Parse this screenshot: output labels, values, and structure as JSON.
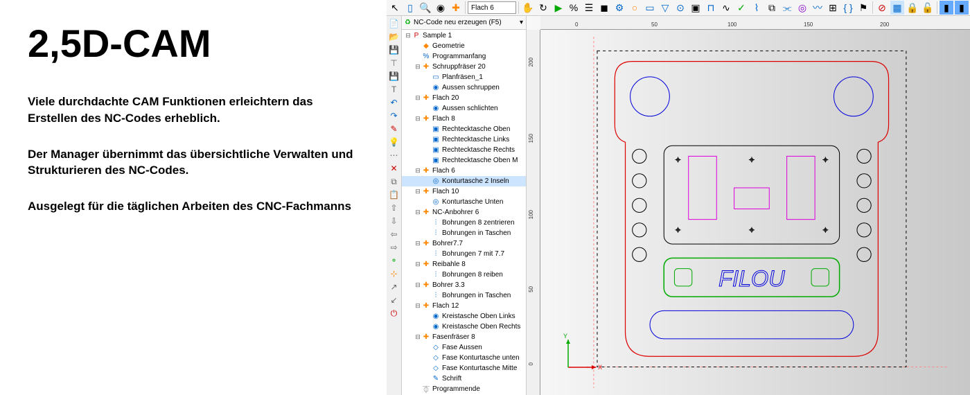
{
  "marketing": {
    "title": "2,5D-CAM",
    "p1": "Viele durchdachte CAM Funktionen erleichtern das Erstellen des NC-Codes erheblich.",
    "p2": "Der Manager übernimmt das übersichtliche Verwalten und Strukturieren des NC-Codes.",
    "p3": "Ausgelegt für die täglichen Arbeiten des CNC-Fachmanns"
  },
  "toolbar": {
    "dropdown_value": "Flach 6"
  },
  "tree": {
    "header": "NC-Code neu erzeugen (F5)",
    "items": [
      {
        "depth": 0,
        "exp": "⊟",
        "icon": "P",
        "cls": "ic-red",
        "label": "Sample 1"
      },
      {
        "depth": 1,
        "exp": "",
        "icon": "◆",
        "cls": "ic-orange",
        "label": "Geometrie"
      },
      {
        "depth": 1,
        "exp": "",
        "icon": "%",
        "cls": "ic-blue",
        "label": "Programmanfang"
      },
      {
        "depth": 1,
        "exp": "⊟",
        "icon": "✚",
        "cls": "ic-orange",
        "label": "Schruppfräser 20"
      },
      {
        "depth": 2,
        "exp": "",
        "icon": "▭",
        "cls": "ic-blue",
        "label": "Planfräsen_1"
      },
      {
        "depth": 2,
        "exp": "",
        "icon": "◉",
        "cls": "ic-blue",
        "label": "Aussen schruppen"
      },
      {
        "depth": 1,
        "exp": "⊟",
        "icon": "✚",
        "cls": "ic-orange",
        "label": "Flach 20"
      },
      {
        "depth": 2,
        "exp": "",
        "icon": "◉",
        "cls": "ic-blue",
        "label": "Aussen schlichten"
      },
      {
        "depth": 1,
        "exp": "⊟",
        "icon": "✚",
        "cls": "ic-orange",
        "label": "Flach 8"
      },
      {
        "depth": 2,
        "exp": "",
        "icon": "▣",
        "cls": "ic-blue",
        "label": "Rechtecktasche Oben"
      },
      {
        "depth": 2,
        "exp": "",
        "icon": "▣",
        "cls": "ic-blue",
        "label": "Rechtecktasche Links"
      },
      {
        "depth": 2,
        "exp": "",
        "icon": "▣",
        "cls": "ic-blue",
        "label": "Rechtecktasche Rechts"
      },
      {
        "depth": 2,
        "exp": "",
        "icon": "▣",
        "cls": "ic-blue",
        "label": "Rechtecktasche Oben M"
      },
      {
        "depth": 1,
        "exp": "⊟",
        "icon": "✚",
        "cls": "ic-orange",
        "label": "Flach 6"
      },
      {
        "depth": 2,
        "exp": "",
        "icon": "◎",
        "cls": "ic-blue",
        "label": "Konturtasche 2 Inseln",
        "selected": true
      },
      {
        "depth": 1,
        "exp": "⊟",
        "icon": "✚",
        "cls": "ic-orange",
        "label": "Flach 10"
      },
      {
        "depth": 2,
        "exp": "",
        "icon": "◎",
        "cls": "ic-blue",
        "label": "Konturtasche Unten"
      },
      {
        "depth": 1,
        "exp": "⊟",
        "icon": "✚",
        "cls": "ic-orange",
        "label": "NC-Anbohrer 6"
      },
      {
        "depth": 2,
        "exp": "",
        "icon": "⫶",
        "cls": "ic-blue",
        "label": "Bohrungen 8 zentrieren"
      },
      {
        "depth": 2,
        "exp": "",
        "icon": "⫶",
        "cls": "ic-blue",
        "label": "Bohrungen in Taschen"
      },
      {
        "depth": 1,
        "exp": "⊟",
        "icon": "✚",
        "cls": "ic-orange",
        "label": "Bohrer7.7"
      },
      {
        "depth": 2,
        "exp": "",
        "icon": "⫶",
        "cls": "ic-blue",
        "label": "Bohrungen 7 mit 7.7"
      },
      {
        "depth": 1,
        "exp": "⊟",
        "icon": "✚",
        "cls": "ic-orange",
        "label": "Reibahle 8"
      },
      {
        "depth": 2,
        "exp": "",
        "icon": "⫶",
        "cls": "ic-blue",
        "label": "Bohrungen 8 reiben"
      },
      {
        "depth": 1,
        "exp": "⊟",
        "icon": "✚",
        "cls": "ic-orange",
        "label": "Bohrer 3.3"
      },
      {
        "depth": 2,
        "exp": "",
        "icon": "⫶",
        "cls": "ic-blue",
        "label": "Bohrungen in Taschen"
      },
      {
        "depth": 1,
        "exp": "⊟",
        "icon": "✚",
        "cls": "ic-orange",
        "label": "Flach 12"
      },
      {
        "depth": 2,
        "exp": "",
        "icon": "◉",
        "cls": "ic-blue",
        "label": "Kreistasche Oben Links"
      },
      {
        "depth": 2,
        "exp": "",
        "icon": "◉",
        "cls": "ic-blue",
        "label": "Kreistasche Oben Rechts"
      },
      {
        "depth": 1,
        "exp": "⊟",
        "icon": "✚",
        "cls": "ic-orange",
        "label": "Fasenfräser 8"
      },
      {
        "depth": 2,
        "exp": "",
        "icon": "◇",
        "cls": "ic-blue",
        "label": "Fase Aussen"
      },
      {
        "depth": 2,
        "exp": "",
        "icon": "◇",
        "cls": "ic-blue",
        "label": "Fase Konturtasche unten"
      },
      {
        "depth": 2,
        "exp": "",
        "icon": "◇",
        "cls": "ic-blue",
        "label": "Fase Konturtasche Mitte"
      },
      {
        "depth": 2,
        "exp": "",
        "icon": "✎",
        "cls": "ic-blue",
        "label": "Schrift"
      },
      {
        "depth": 1,
        "exp": "",
        "icon": "⏁",
        "cls": "ic-gray",
        "label": "Programmende"
      }
    ]
  },
  "ruler": {
    "h": [
      {
        "v": "0",
        "p": 50
      },
      {
        "v": "50",
        "p": 160
      },
      {
        "v": "100",
        "p": 270
      },
      {
        "v": "150",
        "p": 380
      },
      {
        "v": "200",
        "p": 490
      }
    ],
    "v": [
      {
        "v": "200",
        "p": 40
      },
      {
        "v": "150",
        "p": 150
      },
      {
        "v": "100",
        "p": 260
      },
      {
        "v": "50",
        "p": 370
      },
      {
        "v": "0",
        "p": 480
      }
    ]
  },
  "axis": {
    "x": "X",
    "y": "Y"
  }
}
